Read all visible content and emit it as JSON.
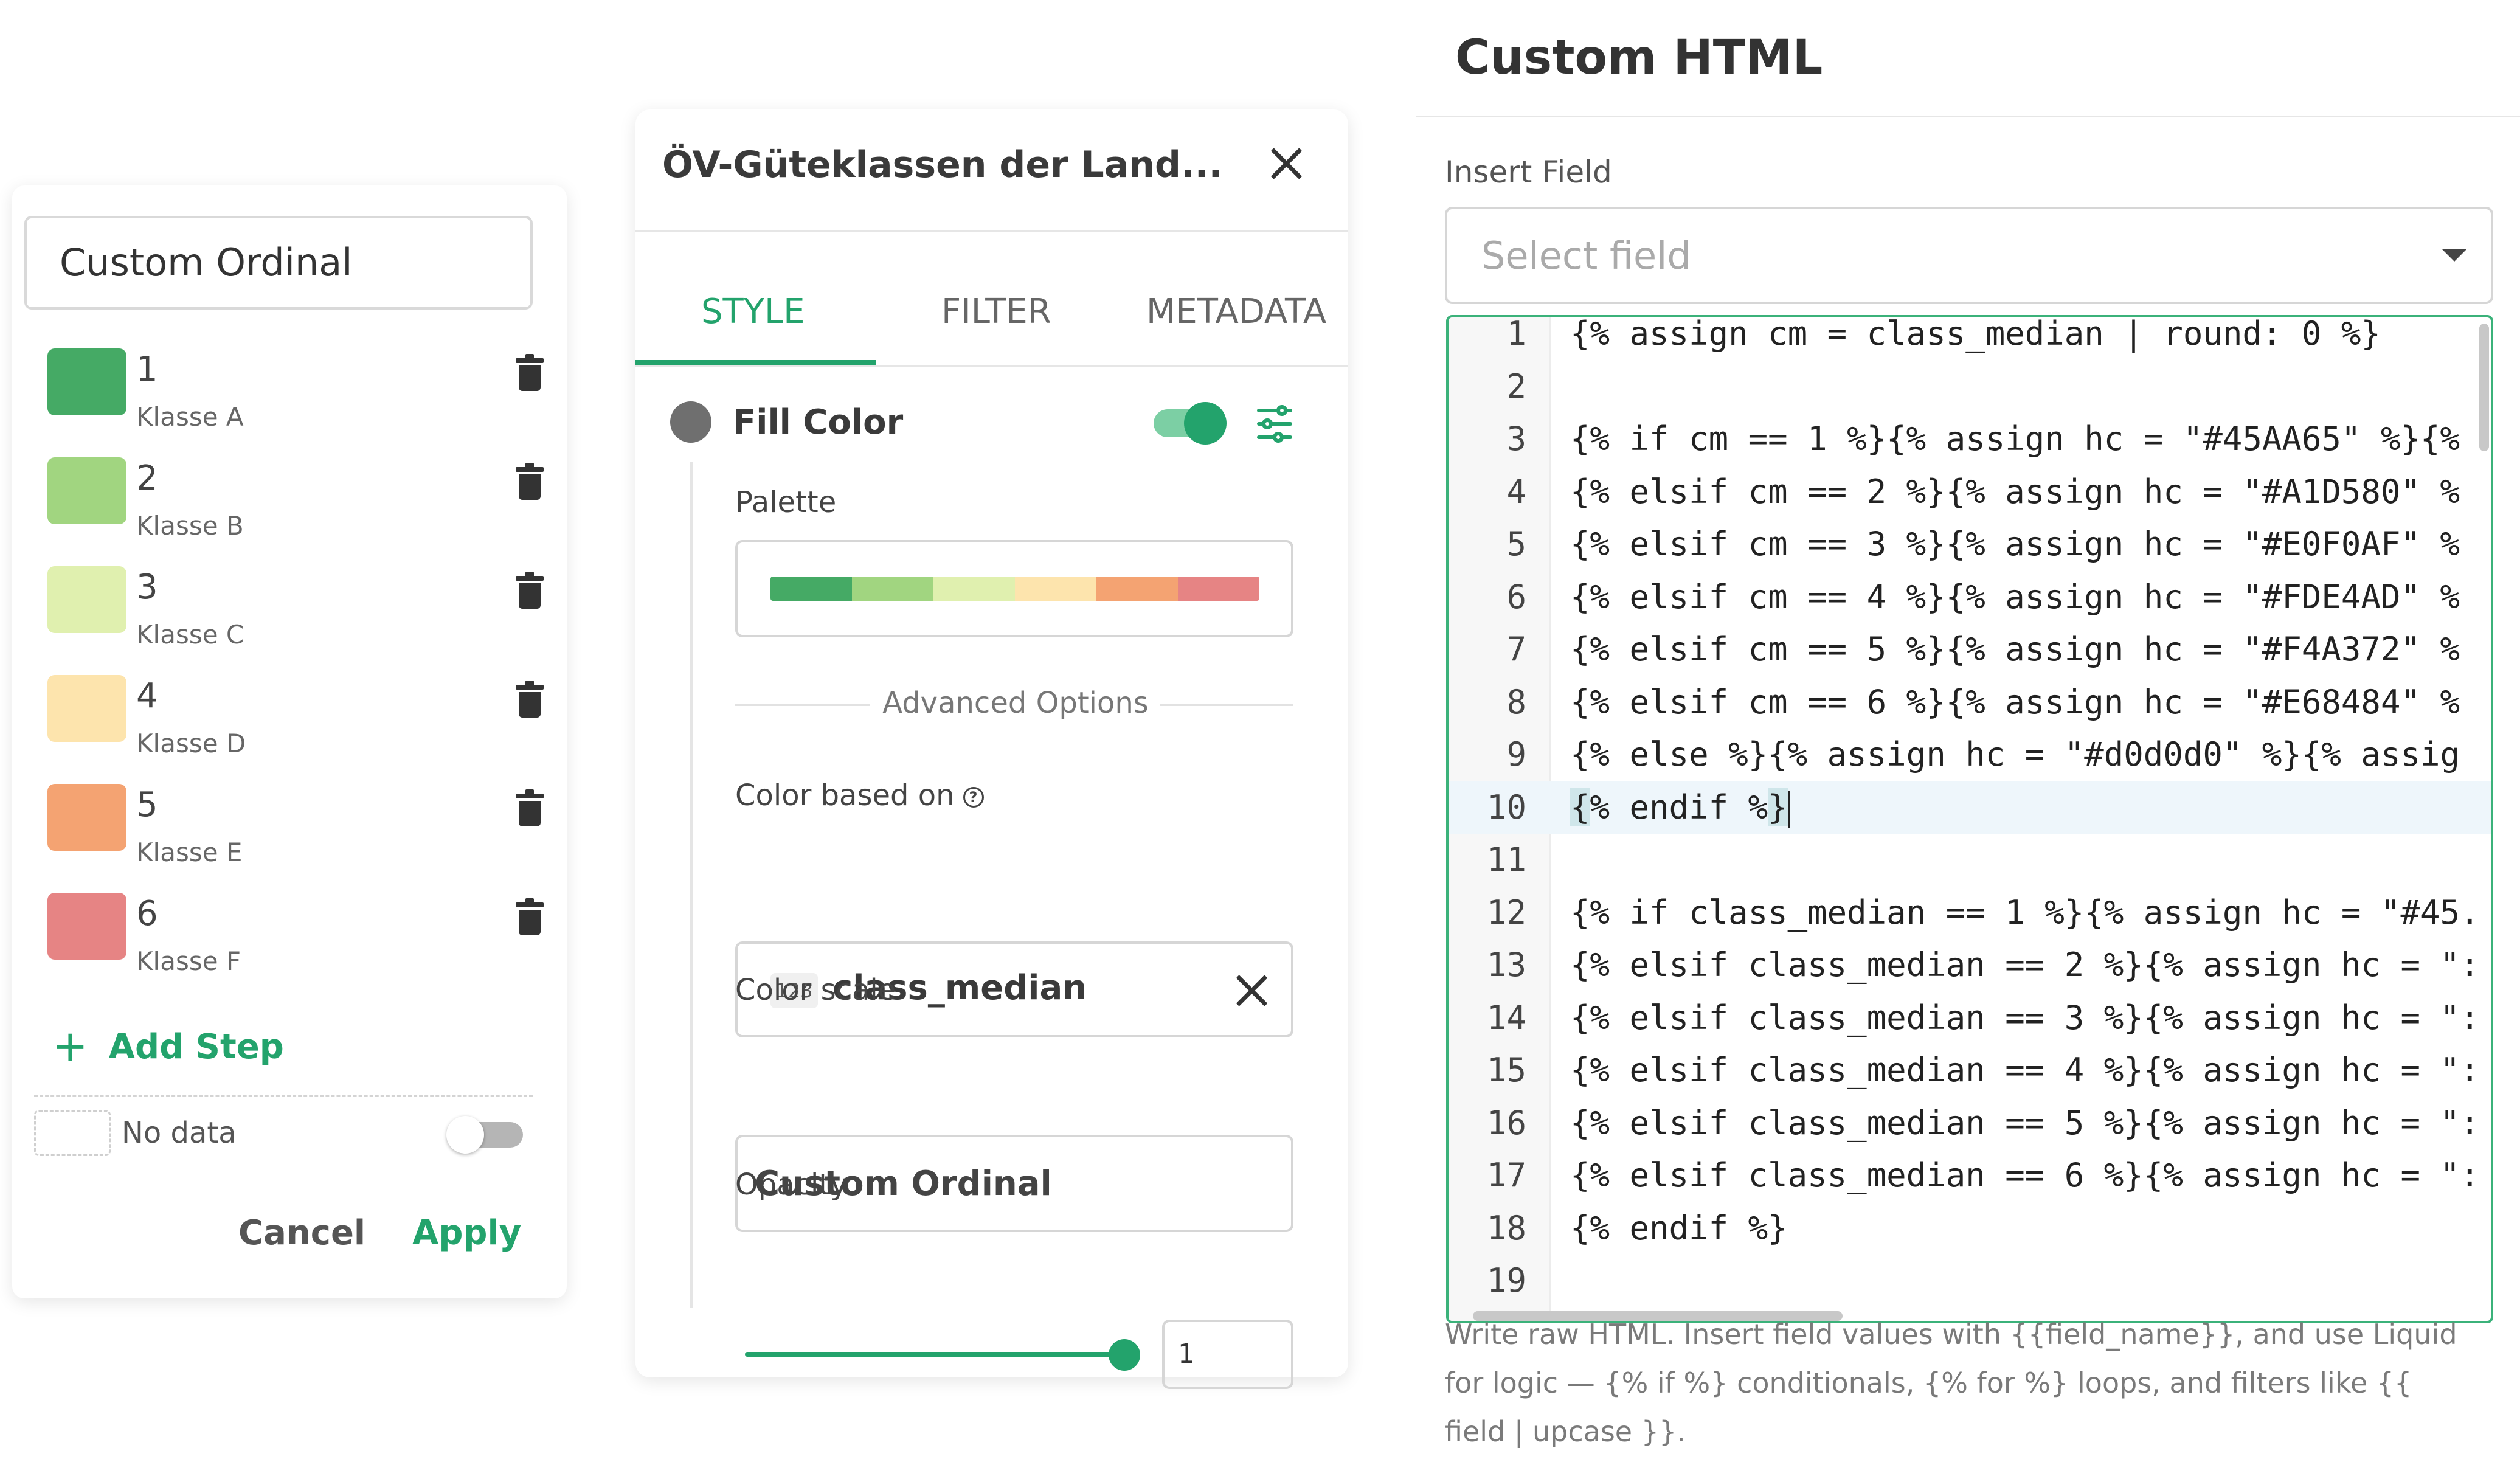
{
  "ordinal_panel": {
    "scale_name": "Custom Ordinal",
    "steps": [
      {
        "num": "1",
        "label": "Klasse A",
        "color": "#45AA65"
      },
      {
        "num": "2",
        "label": "Klasse B",
        "color": "#A1D580"
      },
      {
        "num": "3",
        "label": "Klasse C",
        "color": "#E0F0AF"
      },
      {
        "num": "4",
        "label": "Klasse D",
        "color": "#FDE4AD"
      },
      {
        "num": "5",
        "label": "Klasse E",
        "color": "#F4A372"
      },
      {
        "num": "6",
        "label": "Klasse F",
        "color": "#E68484"
      }
    ],
    "add_step_label": "Add Step",
    "no_data_label": "No data",
    "no_data_enabled": false,
    "cancel_label": "Cancel",
    "apply_label": "Apply"
  },
  "style_panel": {
    "title": "ÖV-Güteklassen der Land...",
    "tabs": [
      {
        "label": "STYLE",
        "active": true
      },
      {
        "label": "FILTER",
        "active": false
      },
      {
        "label": "METADATA",
        "active": false
      }
    ],
    "fill_color_label": "Fill Color",
    "fill_color_enabled": true,
    "palette_label": "Palette",
    "palette_colors": [
      "#45AA65",
      "#A1D580",
      "#E0F0AF",
      "#FDE4AD",
      "#F4A372",
      "#E68484"
    ],
    "advanced_options_label": "Advanced Options",
    "color_based_on_label": "Color based on",
    "color_based_on_type_badge": "123",
    "color_based_on_value": "class_median",
    "color_scale_label": "Color scale",
    "color_scale_value": "Custom Ordinal",
    "opacity_label": "Opacity",
    "opacity_value": "1",
    "accent_color": "#23A36C"
  },
  "html_panel": {
    "title": "Custom HTML",
    "insert_field_label": "Insert Field",
    "select_placeholder": "Select field",
    "active_line": 10,
    "code_lines": [
      {
        "n": "1",
        "text": "{% assign cm = class_median | round: 0 %}"
      },
      {
        "n": "2",
        "text": ""
      },
      {
        "n": "3",
        "text": "{% if cm == 1 %}{% assign hc = \"#45AA65\" %}{%"
      },
      {
        "n": "4",
        "text": "{% elsif cm == 2 %}{% assign hc = \"#A1D580\" %"
      },
      {
        "n": "5",
        "text": "{% elsif cm == 3 %}{% assign hc = \"#E0F0AF\" %"
      },
      {
        "n": "6",
        "text": "{% elsif cm == 4 %}{% assign hc = \"#FDE4AD\" %"
      },
      {
        "n": "7",
        "text": "{% elsif cm == 5 %}{% assign hc = \"#F4A372\" %"
      },
      {
        "n": "8",
        "text": "{% elsif cm == 6 %}{% assign hc = \"#E68484\" %"
      },
      {
        "n": "9",
        "text": "{% else %}{% assign hc = \"#d0d0d0\" %}{% assig"
      },
      {
        "n": "10",
        "text": "{% endif %}"
      },
      {
        "n": "11",
        "text": ""
      },
      {
        "n": "12",
        "text": "{% if class_median == 1 %}{% assign hc = \"#45."
      },
      {
        "n": "13",
        "text": "{% elsif class_median == 2 %}{% assign hc = \":"
      },
      {
        "n": "14",
        "text": "{% elsif class_median == 3 %}{% assign hc = \":"
      },
      {
        "n": "15",
        "text": "{% elsif class_median == 4 %}{% assign hc = \":"
      },
      {
        "n": "16",
        "text": "{% elsif class_median == 5 %}{% assign hc = \":"
      },
      {
        "n": "17",
        "text": "{% elsif class_median == 6 %}{% assign hc = \":"
      },
      {
        "n": "18",
        "text": "{% endif %}"
      },
      {
        "n": "19",
        "text": ""
      }
    ],
    "help_text": "Write raw HTML. Insert field values with {{field_name}}, and use Liquid for logic — {% if %} conditionals, {% for %} loops, and filters like {{ field | upcase }}."
  }
}
